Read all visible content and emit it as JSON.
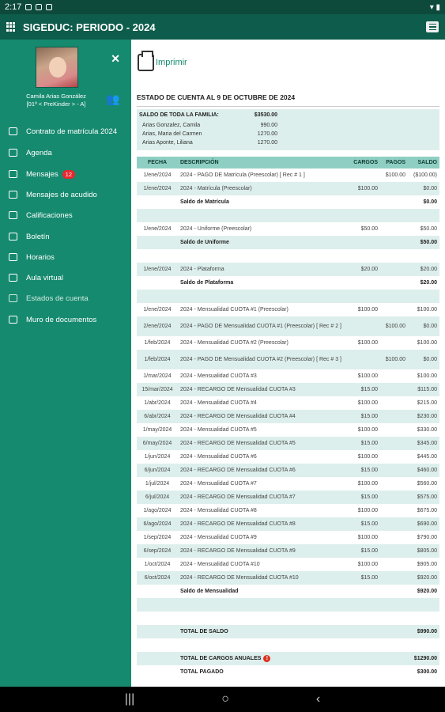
{
  "status": {
    "time": "2:17"
  },
  "header": {
    "title": "SIGEDUC: PERIODO - 2024"
  },
  "user": {
    "name": "Camila Arias González",
    "group": "[01º < PreKinder > - A]"
  },
  "nav": [
    {
      "label": "Contrato de matrícula 2024",
      "icon": "contract-icon"
    },
    {
      "label": "Agenda",
      "icon": "calendar-icon"
    },
    {
      "label": "Mensajes",
      "icon": "mail-icon",
      "badge": "12"
    },
    {
      "label": "Mensajes de acudido",
      "icon": "mail-icon"
    },
    {
      "label": "Calificaciones",
      "icon": "save-icon"
    },
    {
      "label": "Boletín",
      "icon": "bulletin-icon"
    },
    {
      "label": "Horarios",
      "icon": "clock-icon"
    },
    {
      "label": "Aula virtual",
      "icon": "book-icon"
    },
    {
      "label": "Estados de cuenta",
      "icon": "account-icon"
    },
    {
      "label": "Muro de documentos",
      "icon": "wall-icon"
    }
  ],
  "main": {
    "print_label": "Imprimir",
    "estado": "ESTADO DE CUENTA AL 9 DE OCTUBRE DE 2024",
    "family": {
      "label": "SALDO DE TODA LA FAMILIA:",
      "total": "$3530.00",
      "members": [
        {
          "name": "Arias Gonzalez, Camila",
          "value": "990.00"
        },
        {
          "name": "Arias, Maria del Carmen",
          "value": "1270.00"
        },
        {
          "name": "Arias Aponte, Liliana",
          "value": "1270.00"
        }
      ]
    },
    "columns": [
      "FECHA",
      "DESCRIPCIÓN",
      "CARGOS",
      "PAGOS",
      "SALDO"
    ],
    "rows": [
      [
        "1/ene/2024",
        "2024 - PAGO DE Matrícula (Preescolar) [ Rec # 1 ]",
        "",
        "$100.00",
        "($100.00)"
      ],
      [
        "1/ene/2024",
        "2024 - Matrícula (Preescolar)",
        "$100.00",
        "",
        "$0.00"
      ],
      [
        "",
        "Saldo de Matrícula",
        "",
        "",
        "$0.00"
      ],
      [
        "",
        "",
        "",
        "",
        ""
      ],
      [
        "1/ene/2024",
        "2024 - Uniforme (Preescolar)",
        "$50.00",
        "",
        "$50.00"
      ],
      [
        "",
        "Saldo de Uniforme",
        "",
        "",
        "$50.00"
      ],
      [
        "",
        "",
        "",
        "",
        ""
      ],
      [
        "1/ene/2024",
        "2024 - Plataforma",
        "$20.00",
        "",
        "$20.00"
      ],
      [
        "",
        "Saldo de Plataforma",
        "",
        "",
        "$20.00"
      ],
      [
        "",
        "",
        "",
        "",
        ""
      ],
      [
        "1/ene/2024",
        "2024 - Mensualidad CUOTA #1 (Preescolar)",
        "$100.00",
        "",
        "$100.00"
      ],
      [
        "2/ene/2024",
        "2024 - PAGO DE Mensualidad CUOTA #1 (Preescolar) [ Rec # 2 ]",
        "",
        "$100.00",
        "$0.00"
      ],
      [
        "1/feb/2024",
        "2024 - Mensualidad CUOTA #2 (Preescolar)",
        "$100.00",
        "",
        "$100.00"
      ],
      [
        "1/feb/2024",
        "2024 - PAGO DE Mensualidad CUOTA #2 (Preescolar) [ Rec # 3 ]",
        "",
        "$100.00",
        "$0.00"
      ],
      [
        "1/mar/2024",
        "2024 - Mensualidad CUOTA #3",
        "$100.00",
        "",
        "$100.00"
      ],
      [
        "15/mar/2024",
        "2024 - RECARGO DE Mensualidad CUOTA #3",
        "$15.00",
        "",
        "$115.00"
      ],
      [
        "1/abr/2024",
        "2024 - Mensualidad CUOTA #4",
        "$100.00",
        "",
        "$215.00"
      ],
      [
        "6/abr/2024",
        "2024 - RECARGO DE Mensualidad CUOTA #4",
        "$15.00",
        "",
        "$230.00"
      ],
      [
        "1/may/2024",
        "2024 - Mensualidad CUOTA #5",
        "$100.00",
        "",
        "$330.00"
      ],
      [
        "6/may/2024",
        "2024 - RECARGO DE Mensualidad CUOTA #5",
        "$15.00",
        "",
        "$345.00"
      ],
      [
        "1/jun/2024",
        "2024 - Mensualidad CUOTA #6",
        "$100.00",
        "",
        "$445.00"
      ],
      [
        "6/jun/2024",
        "2024 - RECARGO DE Mensualidad CUOTA #6",
        "$15.00",
        "",
        "$460.00"
      ],
      [
        "1/jul/2024",
        "2024 - Mensualidad CUOTA #7",
        "$100.00",
        "",
        "$560.00"
      ],
      [
        "6/jul/2024",
        "2024 - RECARGO DE Mensualidad CUOTA #7",
        "$15.00",
        "",
        "$575.00"
      ],
      [
        "1/ago/2024",
        "2024 - Mensualidad CUOTA #8",
        "$100.00",
        "",
        "$675.00"
      ],
      [
        "6/ago/2024",
        "2024 - RECARGO DE Mensualidad CUOTA #8",
        "$15.00",
        "",
        "$690.00"
      ],
      [
        "1/sep/2024",
        "2024 - Mensualidad CUOTA #9",
        "$100.00",
        "",
        "$790.00"
      ],
      [
        "6/sep/2024",
        "2024 - RECARGO DE Mensualidad CUOTA #9",
        "$15.00",
        "",
        "$805.00"
      ],
      [
        "1/oct/2024",
        "2024 - Mensualidad CUOTA #10",
        "$100.00",
        "",
        "$905.00"
      ],
      [
        "6/oct/2024",
        "2024 - RECARGO DE Mensualidad CUOTA #10",
        "$15.00",
        "",
        "$920.00"
      ],
      [
        "",
        "Saldo de Mensualidad",
        "",
        "",
        "$920.00"
      ],
      [
        "",
        "",
        "",
        "",
        ""
      ],
      [
        "",
        "",
        "",
        "",
        ""
      ],
      [
        "",
        "TOTAL DE SALDO",
        "",
        "",
        "$990.00"
      ],
      [
        "",
        "",
        "",
        "",
        ""
      ],
      [
        "",
        "TOTAL DE CARGOS ANUALES",
        "",
        "",
        "$1290.00"
      ],
      [
        "",
        "TOTAL PAGADO",
        "",
        "",
        "$300.00"
      ]
    ]
  }
}
